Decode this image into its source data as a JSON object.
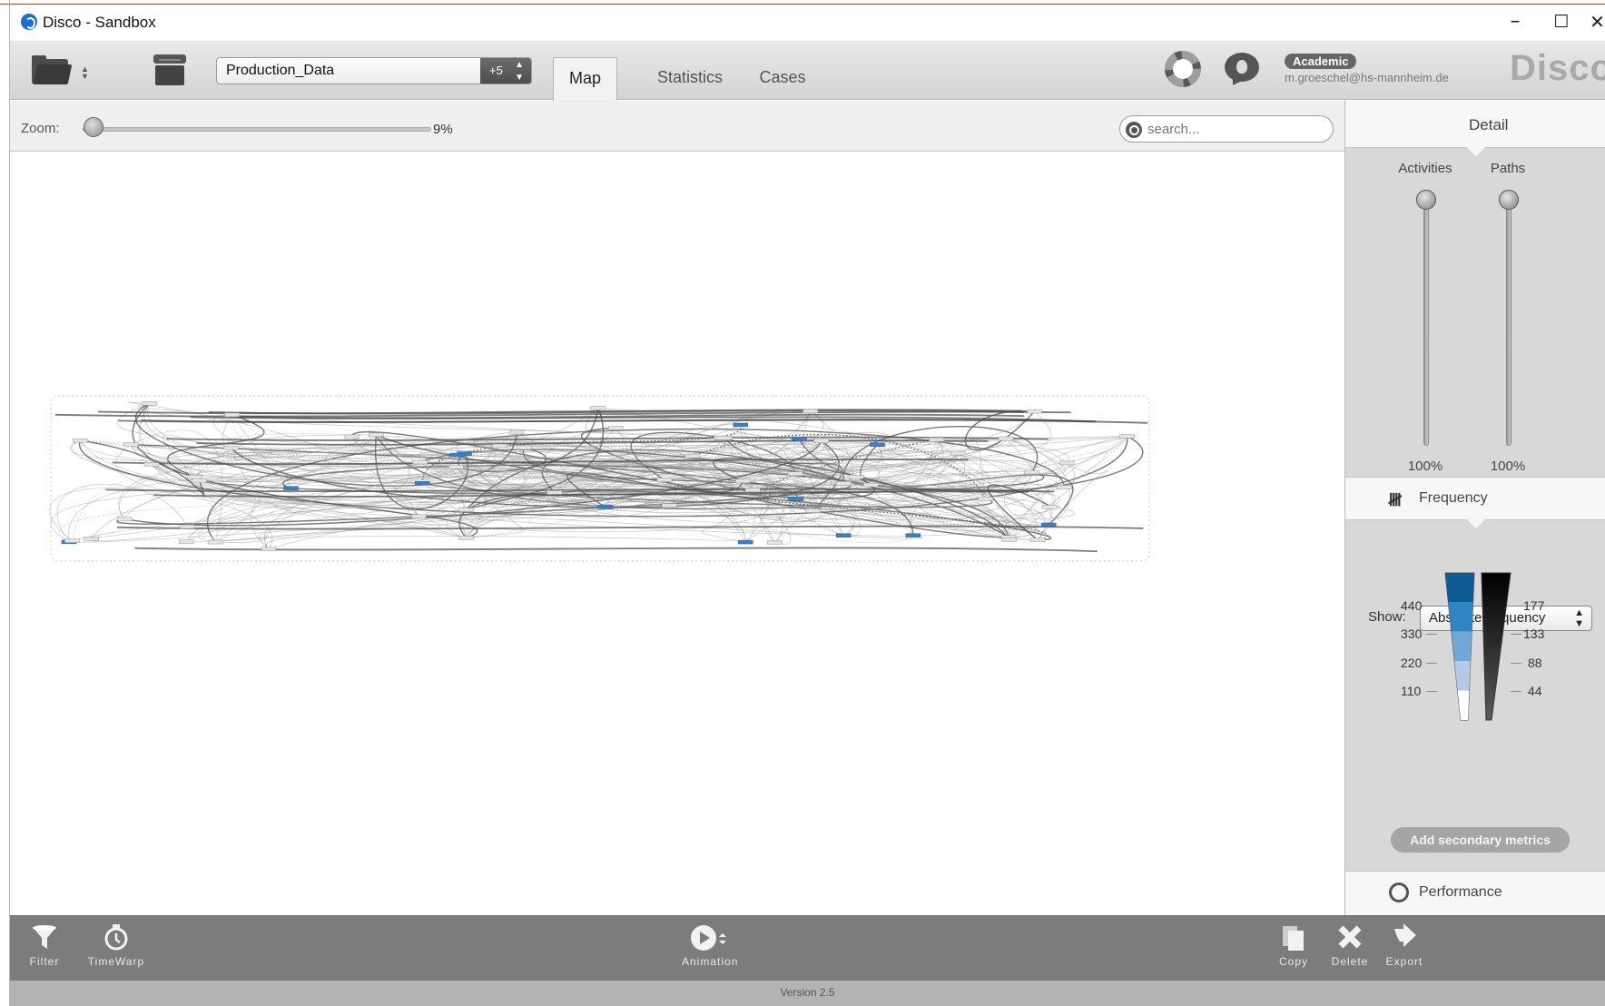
{
  "window": {
    "title": "Disco - Sandbox",
    "minimize": "–",
    "maximize": "☐",
    "close": "✕"
  },
  "toolbar": {
    "dataset_name": "Production_Data",
    "dataset_badge": "+5",
    "tabs": [
      {
        "label": "Map",
        "active": true
      },
      {
        "label": "Statistics",
        "active": false
      },
      {
        "label": "Cases",
        "active": false
      }
    ],
    "license_badge": "Academic",
    "user_email": "m.groeschel@hs-mannheim.de",
    "brand": "Disco"
  },
  "zoom": {
    "label": "Zoom:",
    "value_text": "9%",
    "value": 0.09
  },
  "search": {
    "placeholder": "search..."
  },
  "detail_panel": {
    "title": "Detail",
    "activities": {
      "label": "Activities",
      "value_text": "100%",
      "value": 1.0
    },
    "paths": {
      "label": "Paths",
      "value_text": "100%",
      "value": 1.0
    }
  },
  "frequency_panel": {
    "title": "Frequency",
    "show_label": "Show:",
    "show_value": "Absolute frequency",
    "activity_scale": [
      "440",
      "330",
      "220",
      "110"
    ],
    "path_scale": [
      "177",
      "133",
      "88",
      "44"
    ],
    "activity_scale_colors": [
      "#0d5a94",
      "#2f86c3",
      "#6fa8d4",
      "#b3c9e6",
      "#ffffff"
    ],
    "add_metrics_label": "Add secondary metrics"
  },
  "performance_panel": {
    "title": "Performance"
  },
  "bottom_toolbar": {
    "filter": "Filter",
    "timewarp": "TimeWarp",
    "animation": "Animation",
    "copy": "Copy",
    "delete": "Delete",
    "export": "Export"
  },
  "status": {
    "version": "Version 2.5"
  }
}
